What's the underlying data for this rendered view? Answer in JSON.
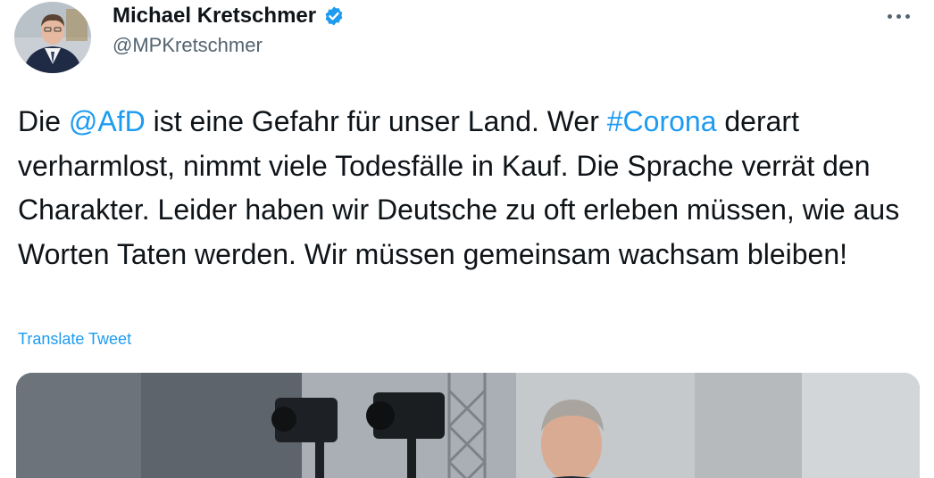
{
  "author": {
    "display_name": "Michael Kretschmer",
    "handle": "@MPKretschmer",
    "verified": true,
    "verified_icon": "verified-badge-icon",
    "avatar_icon": "avatar"
  },
  "menu": {
    "icon": "more-horizontal-icon"
  },
  "tweet": {
    "segments": [
      {
        "type": "text",
        "value": "Die "
      },
      {
        "type": "mention",
        "value": "@AfD"
      },
      {
        "type": "text",
        "value": " ist eine Gefahr für unser Land. Wer "
      },
      {
        "type": "hashtag",
        "value": "#Corona"
      },
      {
        "type": "text",
        "value": " derart verharmlost, nimmt viele Todesfälle in Kauf. Die Sprache verrät den Charakter. Leider haben wir Deutsche zu oft erleben müssen, wie aus Worten Taten werden. Wir müssen gemeinsam wachsam bleiben!"
      }
    ],
    "translate_label": "Translate Tweet"
  },
  "colors": {
    "link": "#1d9bf0",
    "text": "#0f1419",
    "secondary": "#536471",
    "verified": "#1d9bf0"
  }
}
